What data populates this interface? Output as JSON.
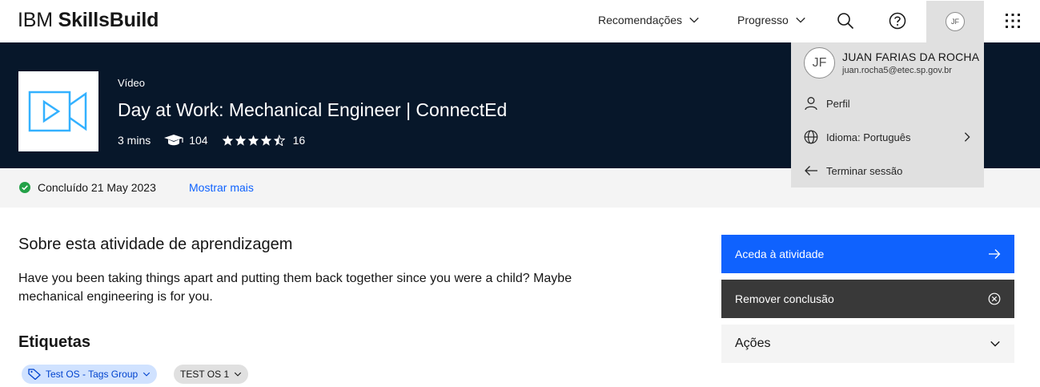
{
  "header": {
    "brand_light": "IBM ",
    "brand_bold": "SkillsBuild",
    "nav": [
      {
        "label": "Recomendações"
      },
      {
        "label": "Progresso"
      }
    ],
    "avatar_initials": "JF"
  },
  "activity": {
    "kind": "Vídeo",
    "title": "Day at Work: Mechanical Engineer | ConnectEd",
    "duration": "3 mins",
    "learners": "104",
    "rating": 4.5,
    "rating_count": "16"
  },
  "status": {
    "completed": "Concluído 21 May 2023",
    "show_more": "Mostrar mais"
  },
  "about": {
    "heading": "Sobre esta atividade de aprendizagem",
    "text": "Have you been taking things apart and putting them back together since you were a child? Maybe mechanical engineering is for you."
  },
  "tags": {
    "heading": "Etiquetas",
    "items": [
      {
        "label": "Test OS - Tags Group"
      },
      {
        "label": "TEST OS 1"
      }
    ]
  },
  "actions": {
    "access": "Aceda à atividade",
    "remove": "Remover conclusão",
    "more": "Ações"
  },
  "user_menu": {
    "initials": "JF",
    "name": "JUAN FARIAS DA ROCHA",
    "email": "juan.rocha5@etec.sp.gov.br",
    "items": [
      {
        "label": "Perfil",
        "icon": "user-icon"
      },
      {
        "label": "Idioma: Português",
        "icon": "globe-icon"
      },
      {
        "label": "Terminar sessão",
        "icon": "arrow-left-icon"
      }
    ]
  },
  "colors": {
    "banner": "#07172a",
    "primary": "#0f62fe",
    "secondary": "#393939",
    "success": "#24a148"
  }
}
